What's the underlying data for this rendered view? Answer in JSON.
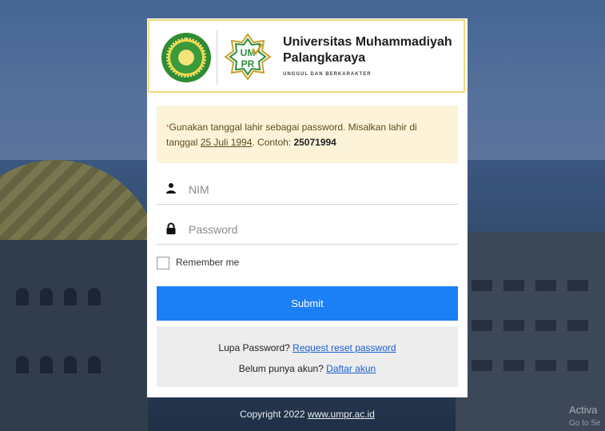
{
  "header": {
    "university_name": "Universitas Muhammadiyah Palangkaraya",
    "tagline": "UNGGUL DAN BERKARAKTER",
    "logo_text": "UMPR"
  },
  "notice": {
    "asterisk": "*",
    "text_before": "Gunakan tanggal lahir sebagai password. Misalkan lahir di tanggal ",
    "date_link": "25 Juli 1994",
    "text_mid": ". Contoh: ",
    "example": "25071994"
  },
  "form": {
    "nim_placeholder": "NIM",
    "password_placeholder": "Password",
    "remember_label": "Remember me",
    "submit_label": "Submit"
  },
  "links": {
    "forgot_text": "Lupa Password? ",
    "forgot_link": "Request reset password",
    "register_text": "Belum punya akun? ",
    "register_link": "Daftar akun"
  },
  "footer": {
    "copyright": "Copyright 2022 ",
    "site_link": "www.umpr.ac.id"
  },
  "watermark": {
    "line1": "Activa",
    "line2": "Go to Se"
  },
  "colors": {
    "submit": "#1b7ff5",
    "notice_bg": "#fcf3d9",
    "header_border": "#f0d97a"
  },
  "icons": [
    "user-icon",
    "lock-icon"
  ]
}
